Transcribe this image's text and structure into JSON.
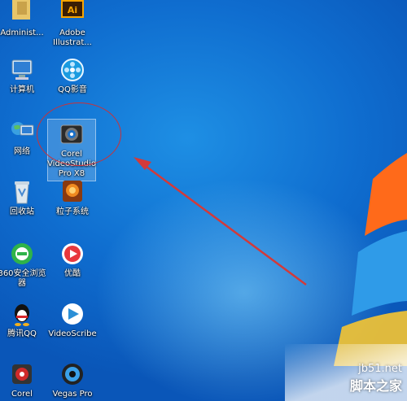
{
  "desktop": {
    "icons": [
      {
        "name": "administrator-folder",
        "label": "Administ..."
      },
      {
        "name": "adobe-illustrator",
        "label": "Adobe\nIllustrat..."
      },
      {
        "name": "computer",
        "label": "计算机"
      },
      {
        "name": "qq-video",
        "label": "QQ影音"
      },
      {
        "name": "network",
        "label": "网络"
      },
      {
        "name": "corel-videostudio",
        "label": "Corel\nVideoStudio\nPro X8"
      },
      {
        "name": "recycle-bin",
        "label": "回收站"
      },
      {
        "name": "particle-system",
        "label": "粒子系统"
      },
      {
        "name": "360-browser",
        "label": "360安全浏览\n器"
      },
      {
        "name": "youku",
        "label": "优酷"
      },
      {
        "name": "tencent-qq",
        "label": "腾讯QQ"
      },
      {
        "name": "videoscribe",
        "label": "VideoScribe"
      },
      {
        "name": "corel",
        "label": "Corel"
      },
      {
        "name": "vegas-pro",
        "label": "Vegas Pro"
      }
    ]
  },
  "watermark": {
    "url": "jb51.net",
    "brand": "脚本之家"
  },
  "colors": {
    "annotation_red": "#c8323a",
    "desktop_blue": "#0f6dcf"
  }
}
